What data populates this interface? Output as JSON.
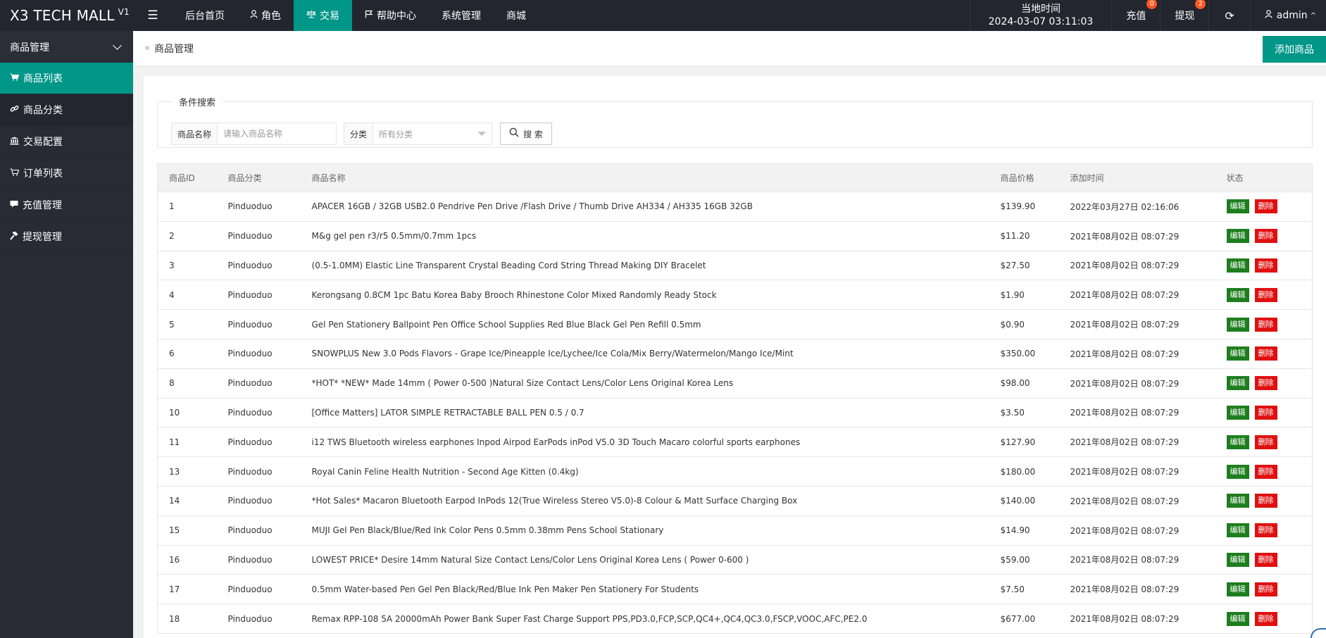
{
  "header": {
    "logo": "X3 TECH MALL",
    "version": "V1",
    "nav": [
      {
        "label": "后台首页",
        "icon": ""
      },
      {
        "label": "角色",
        "icon": "user-icon"
      },
      {
        "label": "交易",
        "icon": "scale-icon",
        "active": true
      },
      {
        "label": "帮助中心",
        "icon": "flag-icon"
      },
      {
        "label": "系统管理",
        "icon": ""
      },
      {
        "label": "商城",
        "icon": ""
      }
    ],
    "time_label": "当地时间",
    "time_value": "2024-03-07 03:11:03",
    "recharge_label": "充值",
    "recharge_badge": "0",
    "withdraw_label": "提现",
    "withdraw_badge": "2",
    "user_label": "admin"
  },
  "sidebar": {
    "group_label": "商品管理",
    "items": [
      {
        "label": "商品列表",
        "icon": "cart-icon"
      },
      {
        "label": "商品分类",
        "icon": "link-icon"
      },
      {
        "label": "交易配置",
        "icon": "bank-icon"
      },
      {
        "label": "订单列表",
        "icon": "cart-outline-icon"
      },
      {
        "label": "充值管理",
        "icon": "card-icon"
      },
      {
        "label": "提现管理",
        "icon": "hammer-icon"
      }
    ]
  },
  "content": {
    "breadcrumb": "商品管理",
    "add_button": "添加商品",
    "search": {
      "legend": "条件搜索",
      "name_label": "商品名称",
      "name_placeholder": "请输入商品名称",
      "category_label": "分类",
      "category_value": "所有分类",
      "search_button": "搜 索"
    },
    "table": {
      "headers": [
        "商品ID",
        "商品分类",
        "商品名称",
        "商品价格",
        "添加时间",
        "状态"
      ],
      "edit_label": "编辑",
      "delete_label": "删除",
      "rows": [
        [
          "1",
          "Pinduoduo",
          "APACER 16GB / 32GB USB2.0 Pendrive Pen Drive /Flash Drive / Thumb Drive AH334 / AH335 16GB 32GB",
          "$139.90",
          "2022年03月27日 02:16:06"
        ],
        [
          "2",
          "Pinduoduo",
          "M&g gel pen r3/r5 0.5mm/0.7mm 1pcs",
          "$11.20",
          "2021年08月02日 08:07:29"
        ],
        [
          "3",
          "Pinduoduo",
          "(0.5-1.0MM) Elastic Line Transparent Crystal Beading Cord String Thread Making DIY Bracelet",
          "$27.50",
          "2021年08月02日 08:07:29"
        ],
        [
          "4",
          "Pinduoduo",
          "Kerongsang 0.8CM 1pc Batu Korea Baby Brooch Rhinestone Color Mixed Randomly Ready Stock",
          "$1.90",
          "2021年08月02日 08:07:29"
        ],
        [
          "5",
          "Pinduoduo",
          "Gel Pen Stationery Ballpoint Pen Office School Supplies Red Blue Black Gel Pen Refill 0.5mm",
          "$0.90",
          "2021年08月02日 08:07:29"
        ],
        [
          "6",
          "Pinduoduo",
          "SNOWPLUS New 3.0 Pods Flavors - Grape Ice/Pineapple Ice/Lychee/Ice Cola/Mix Berry/Watermelon/Mango Ice/Mint",
          "$350.00",
          "2021年08月02日 08:07:29"
        ],
        [
          "8",
          "Pinduoduo",
          "*HOT* *NEW* Made 14mm ( Power 0-500 )Natural Size Contact Lens/Color Lens Original Korea Lens",
          "$98.00",
          "2021年08月02日 08:07:29"
        ],
        [
          "10",
          "Pinduoduo",
          "[Office Matters] LATOR SIMPLE RETRACTABLE BALL PEN 0.5 / 0.7",
          "$3.50",
          "2021年08月02日 08:07:29"
        ],
        [
          "11",
          "Pinduoduo",
          "i12 TWS Bluetooth wireless earphones Inpod Airpod EarPods inPod V5.0 3D Touch Macaro colorful sports earphones",
          "$127.90",
          "2021年08月02日 08:07:29"
        ],
        [
          "13",
          "Pinduoduo",
          "Royal Canin Feline Health Nutrition - Second Age Kitten (0.4kg)",
          "$180.00",
          "2021年08月02日 08:07:29"
        ],
        [
          "14",
          "Pinduoduo",
          "*Hot Sales* Macaron Bluetooth Earpod InPods 12(True Wireless Stereo V5.0)-8 Colour & Matt Surface Charging Box",
          "$140.00",
          "2021年08月02日 08:07:29"
        ],
        [
          "15",
          "Pinduoduo",
          "MUJI Gel Pen Black/Blue/Red Ink Color Pens 0.5mm 0.38mm Pens School Stationary",
          "$14.90",
          "2021年08月02日 08:07:29"
        ],
        [
          "16",
          "Pinduoduo",
          "LOWEST PRICE* Desire 14mm Natural Size Contact Lens/Color Lens Original Korea Lens ( Power 0-600 )",
          "$59.00",
          "2021年08月02日 08:07:29"
        ],
        [
          "17",
          "Pinduoduo",
          "0.5mm Water-based Pen Gel Pen Black/Red/Blue Ink Pen Maker Pen Stationery For Students",
          "$7.50",
          "2021年08月02日 08:07:29"
        ],
        [
          "18",
          "Pinduoduo",
          "Remax RPP-108 5A 20000mAh Power Bank Super Fast Charge Support PPS,PD3.0,FCP,SCP,QC4+,QC4,QC3.0,FSCP,VOOC,AFC,PE2.0",
          "$677.00",
          "2021年08月02日 08:07:29"
        ]
      ]
    }
  },
  "colors": {
    "header_bg": "#23262e",
    "accent": "#009688",
    "edit": "#1e7e1e",
    "delete": "#e01010",
    "badge": "#ff5722"
  }
}
